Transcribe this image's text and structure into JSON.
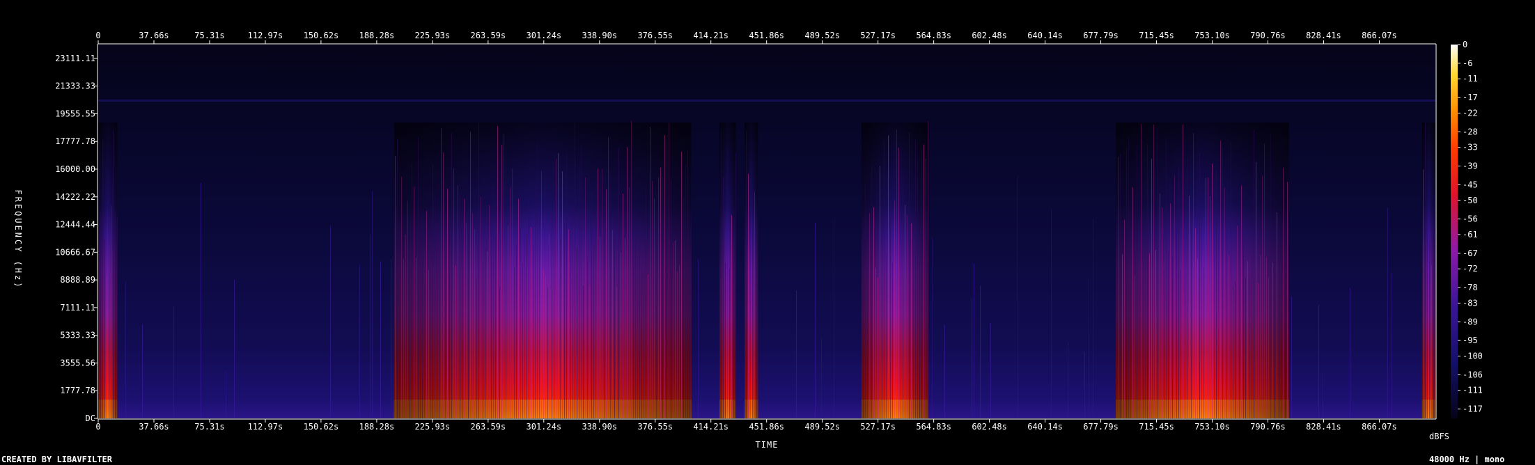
{
  "chart_data": {
    "type": "heatmap",
    "xlabel": "TIME",
    "ylabel": "FREQUENCY (Hz)",
    "x_ticks": [
      "0",
      "37.66s",
      "75.31s",
      "112.97s",
      "150.62s",
      "188.28s",
      "225.93s",
      "263.59s",
      "301.24s",
      "338.90s",
      "376.55s",
      "414.21s",
      "451.86s",
      "489.52s",
      "527.17s",
      "564.83s",
      "602.48s",
      "640.14s",
      "677.79s",
      "715.45s",
      "753.10s",
      "790.76s",
      "828.41s",
      "866.07s"
    ],
    "x_tick_values": [
      0,
      37.66,
      75.31,
      112.97,
      150.62,
      188.28,
      225.93,
      263.59,
      301.24,
      338.9,
      376.55,
      414.21,
      451.86,
      489.52,
      527.17,
      564.83,
      602.48,
      640.14,
      677.79,
      715.45,
      753.1,
      790.76,
      828.41,
      866.07
    ],
    "xlim": [
      0,
      904
    ],
    "y_ticks": [
      "DC",
      "1777.78",
      "3555.56",
      "5333.33",
      "7111.11",
      "8888.89",
      "10666.67",
      "12444.44",
      "14222.22",
      "16000.00",
      "17777.78",
      "19555.55",
      "21333.33",
      "23111.11"
    ],
    "y_tick_values": [
      0,
      1777.78,
      3555.56,
      5333.33,
      7111.11,
      8888.89,
      10666.67,
      12444.44,
      14222.22,
      16000.0,
      17777.78,
      19555.55,
      21333.33,
      23111.11
    ],
    "ylim": [
      0,
      24000
    ],
    "colorbar": {
      "unit": "dBFS",
      "ticks": [
        "0",
        "-6",
        "-11",
        "-17",
        "-22",
        "-28",
        "-33",
        "-39",
        "-45",
        "-50",
        "-56",
        "-61",
        "-67",
        "-72",
        "-78",
        "-83",
        "-89",
        "-95",
        "-100",
        "-106",
        "-111",
        "-117"
      ],
      "tick_values": [
        0,
        -6,
        -11,
        -17,
        -22,
        -28,
        -33,
        -39,
        -45,
        -50,
        -56,
        -61,
        -67,
        -72,
        -78,
        -83,
        -89,
        -95,
        -100,
        -106,
        -111,
        -117
      ],
      "range": [
        -120,
        0
      ]
    },
    "active_segments_s": [
      [
        0,
        13
      ],
      [
        200,
        401
      ],
      [
        420,
        431
      ],
      [
        437,
        446
      ],
      [
        516,
        561
      ],
      [
        688,
        805
      ],
      [
        895,
        904
      ]
    ],
    "footer_left": "CREATED BY LIBAVFILTER",
    "footer_right": "48000 Hz | mono"
  }
}
